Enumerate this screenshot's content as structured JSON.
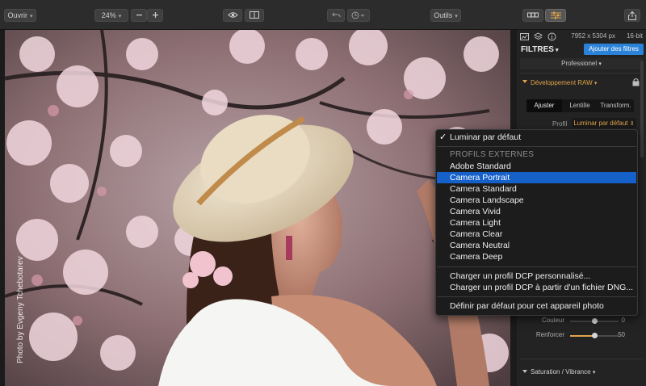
{
  "toolbar": {
    "open_label": "Ouvrir",
    "zoom_value": "24%",
    "tools_label": "Outils"
  },
  "photo": {
    "credit": "Photo by Evgeny Tchebotarev"
  },
  "panel": {
    "image_size": "7952 x 5304 px",
    "bit_depth": "16-bit",
    "filters_title": "FILTRES",
    "add_filters": "Ajouter des filtres",
    "preset_selector": "Professionel",
    "raw_section": "Développement RAW",
    "tabs": [
      "Ajuster",
      "Lentille",
      "Transform."
    ],
    "profile_label": "Profil",
    "profile_value": "Luminar par défaut",
    "sliders": [
      {
        "label": "Couleur",
        "value": "0",
        "fraction": 0.5
      },
      {
        "label": "Renforcer",
        "value": "50",
        "fraction": 0.5
      }
    ],
    "saturation_section": "Saturation / Vibrance"
  },
  "menu": {
    "default_item": "Luminar par défaut",
    "external_header": "PROFILS EXTERNES",
    "profiles": [
      "Adobe Standard",
      "Camera Portrait",
      "Camera Standard",
      "Camera Landscape",
      "Camera Vivid",
      "Camera Light",
      "Camera Clear",
      "Camera Neutral",
      "Camera Deep"
    ],
    "selected_index": 1,
    "load_custom": "Charger un profil DCP personnalisé...",
    "load_from_dng": "Charger un profil DCP à partir d'un fichier DNG...",
    "set_default": "Définir par défaut pour cet appareil photo"
  },
  "colors": {
    "accent_orange": "#e0a44a",
    "accent_blue": "#2b82d9",
    "menu_selection": "#1560c9"
  }
}
